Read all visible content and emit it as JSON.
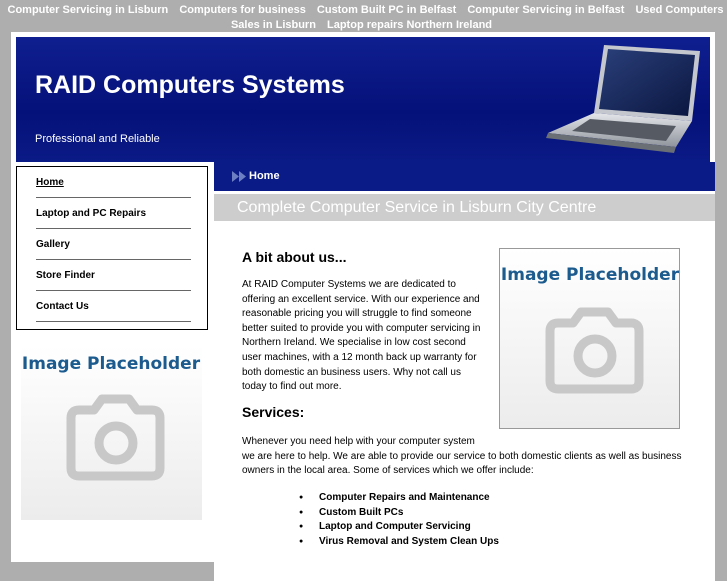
{
  "top_links": [
    "Computer Servicing in Lisburn",
    "Computers for business",
    "Custom Built PC in Belfast",
    "Computer Servicing in Belfast",
    "Used Computers Sales in Lisburn",
    "Laptop repairs Northern Ireland"
  ],
  "header": {
    "title": "RAID Computers Systems",
    "tagline": "Professional and Reliable",
    "image_icon": "laptop-image"
  },
  "sidebar": {
    "items": [
      {
        "label": "Home",
        "active": true
      },
      {
        "label": "Laptop and PC Repairs"
      },
      {
        "label": "Gallery"
      },
      {
        "label": "Store Finder"
      },
      {
        "label": "Contact Us"
      }
    ],
    "image_placeholder": "Image Placeholder"
  },
  "breadcrumb": {
    "current": "Home",
    "icon": "double-arrow-icon"
  },
  "main": {
    "subheading": "Complete Computer Service in Lisburn City Centre",
    "about_heading": "A bit about us...",
    "about_text": "At RAID Computer Systems we are dedicated to offering an excellent service. With our experience and reasonable pricing you will struggle to find someone better suited to provide you with computer servicing in Northern Ireland. We specialise in low cost second user machines, with a 12 month back up warranty for both domestic an business users. Why not call us today to find out more.",
    "image_placeholder": "Image Placeholder",
    "services_heading": "Services:",
    "services_line1": "Whenever you need help with your computer system",
    "services_line2": "we are here to help. We are able to provide our service to both domestic clients as well as business owners in the local area. Some of services which we offer include:",
    "services": [
      "Computer Repairs and Maintenance",
      "Custom Built PCs",
      "Laptop and Computer Servicing",
      "Virus Removal and System Clean Ups"
    ]
  },
  "colors": {
    "header_blue": "#0a1a86",
    "page_bg": "#aeaeae",
    "placeholder_blue": "#1c5b8e",
    "placeholder_grey": "#c8c8c8"
  }
}
